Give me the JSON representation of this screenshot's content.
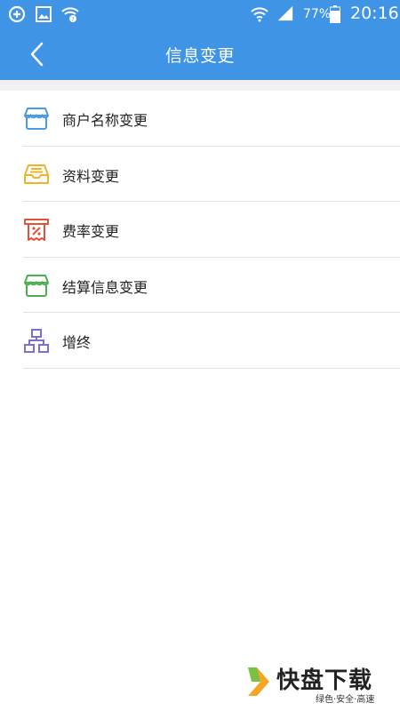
{
  "status_bar": {
    "battery_percent": "77%",
    "time": "20:16"
  },
  "header": {
    "title": "信息变更"
  },
  "menu": {
    "items": [
      {
        "label": "商户名称变更",
        "icon": "store-icon",
        "color": "#4a9be0"
      },
      {
        "label": "资料变更",
        "icon": "inbox-tray-icon",
        "color": "#f0b429"
      },
      {
        "label": "费率变更",
        "icon": "receipt-percent-icon",
        "color": "#e0533a"
      },
      {
        "label": "结算信息变更",
        "icon": "store-icon",
        "color": "#4caf50"
      },
      {
        "label": "增终",
        "icon": "hierarchy-icon",
        "color": "#7b6fd0"
      }
    ]
  },
  "watermark": {
    "main": "快盘下载",
    "sub": "绿色·安全·高速"
  },
  "colors": {
    "header_bg": "#3f94e5"
  }
}
